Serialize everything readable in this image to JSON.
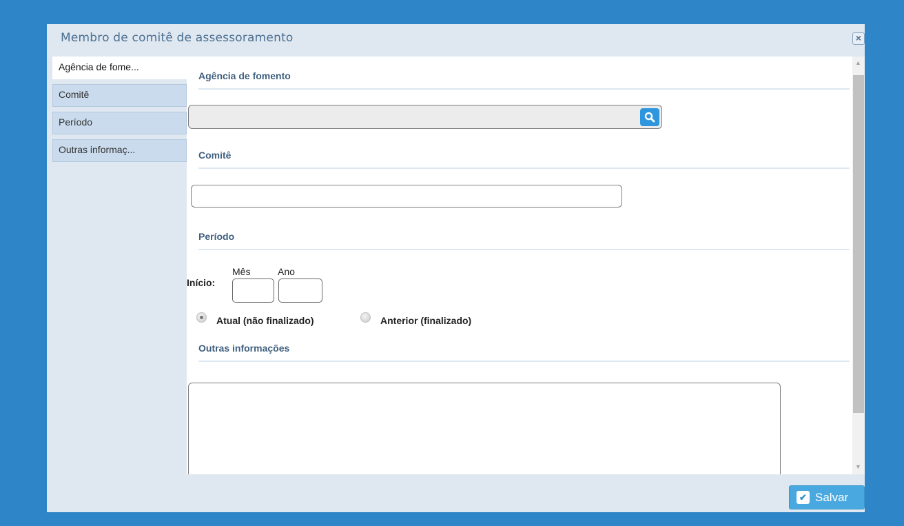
{
  "dialog": {
    "title": "Membro de comitê de assessoramento",
    "close_icon": "close-icon"
  },
  "tabs": [
    {
      "label": "Agência de fome...",
      "active": true
    },
    {
      "label": "Comitê",
      "active": false
    },
    {
      "label": "Período",
      "active": false
    },
    {
      "label": "Outras informaç...",
      "active": false
    }
  ],
  "sections": {
    "agencia": {
      "title": "Agência de fomento",
      "value": "",
      "search_icon": "search-icon"
    },
    "comite": {
      "title": "Comitê",
      "value": ""
    },
    "periodo": {
      "title": "Período",
      "inicio_label": "Início:",
      "mes_label": "Mês",
      "ano_label": "Ano",
      "mes_value": "",
      "ano_value": "",
      "radio_atual": "Atual (não finalizado)",
      "radio_anterior": "Anterior (finalizado)",
      "selected": "atual"
    },
    "outras": {
      "title": "Outras informações",
      "value": ""
    }
  },
  "footer": {
    "save_label": "Salvar",
    "save_icon": "check-icon"
  },
  "colors": {
    "background": "#2e86c8",
    "dialog": "#dfe8f1",
    "accent": "#4aa8e0",
    "section_title": "#3f5f7f"
  }
}
